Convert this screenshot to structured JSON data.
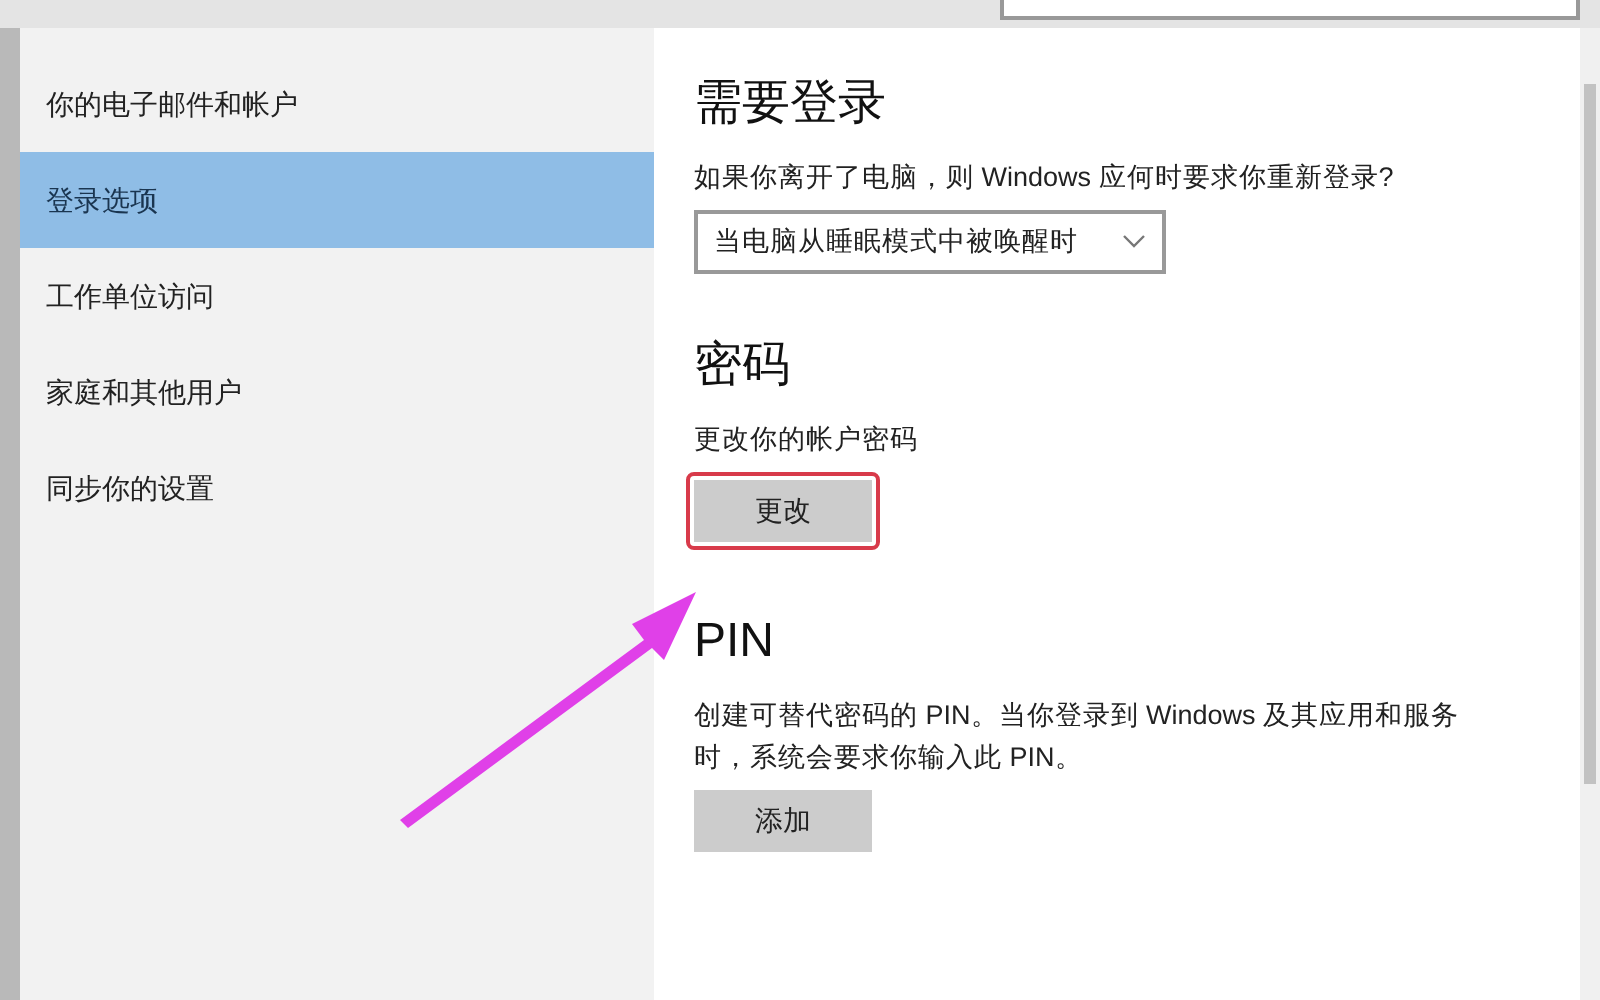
{
  "sidebar": {
    "items": [
      {
        "label": "你的电子邮件和帐户",
        "selected": false
      },
      {
        "label": "登录选项",
        "selected": true
      },
      {
        "label": "工作单位访问",
        "selected": false
      },
      {
        "label": "家庭和其他用户",
        "selected": false
      },
      {
        "label": "同步你的设置",
        "selected": false
      }
    ]
  },
  "sections": [
    {
      "kind": "dropdown",
      "title": "需要登录",
      "description": "如果你离开了电脑，则 Windows 应何时要求你重新登录?",
      "value": "当电脑从睡眠模式中被唤醒时"
    },
    {
      "kind": "button",
      "title": "密码",
      "description": "更改你的帐户密码",
      "button": "更改",
      "highlighted": true
    },
    {
      "kind": "button",
      "title": "PIN",
      "description": "创建可替代密码的 PIN。当你登录到 Windows 及其应用和服务时，系统会要求你输入此 PIN。",
      "button": "添加",
      "highlighted": false
    }
  ]
}
